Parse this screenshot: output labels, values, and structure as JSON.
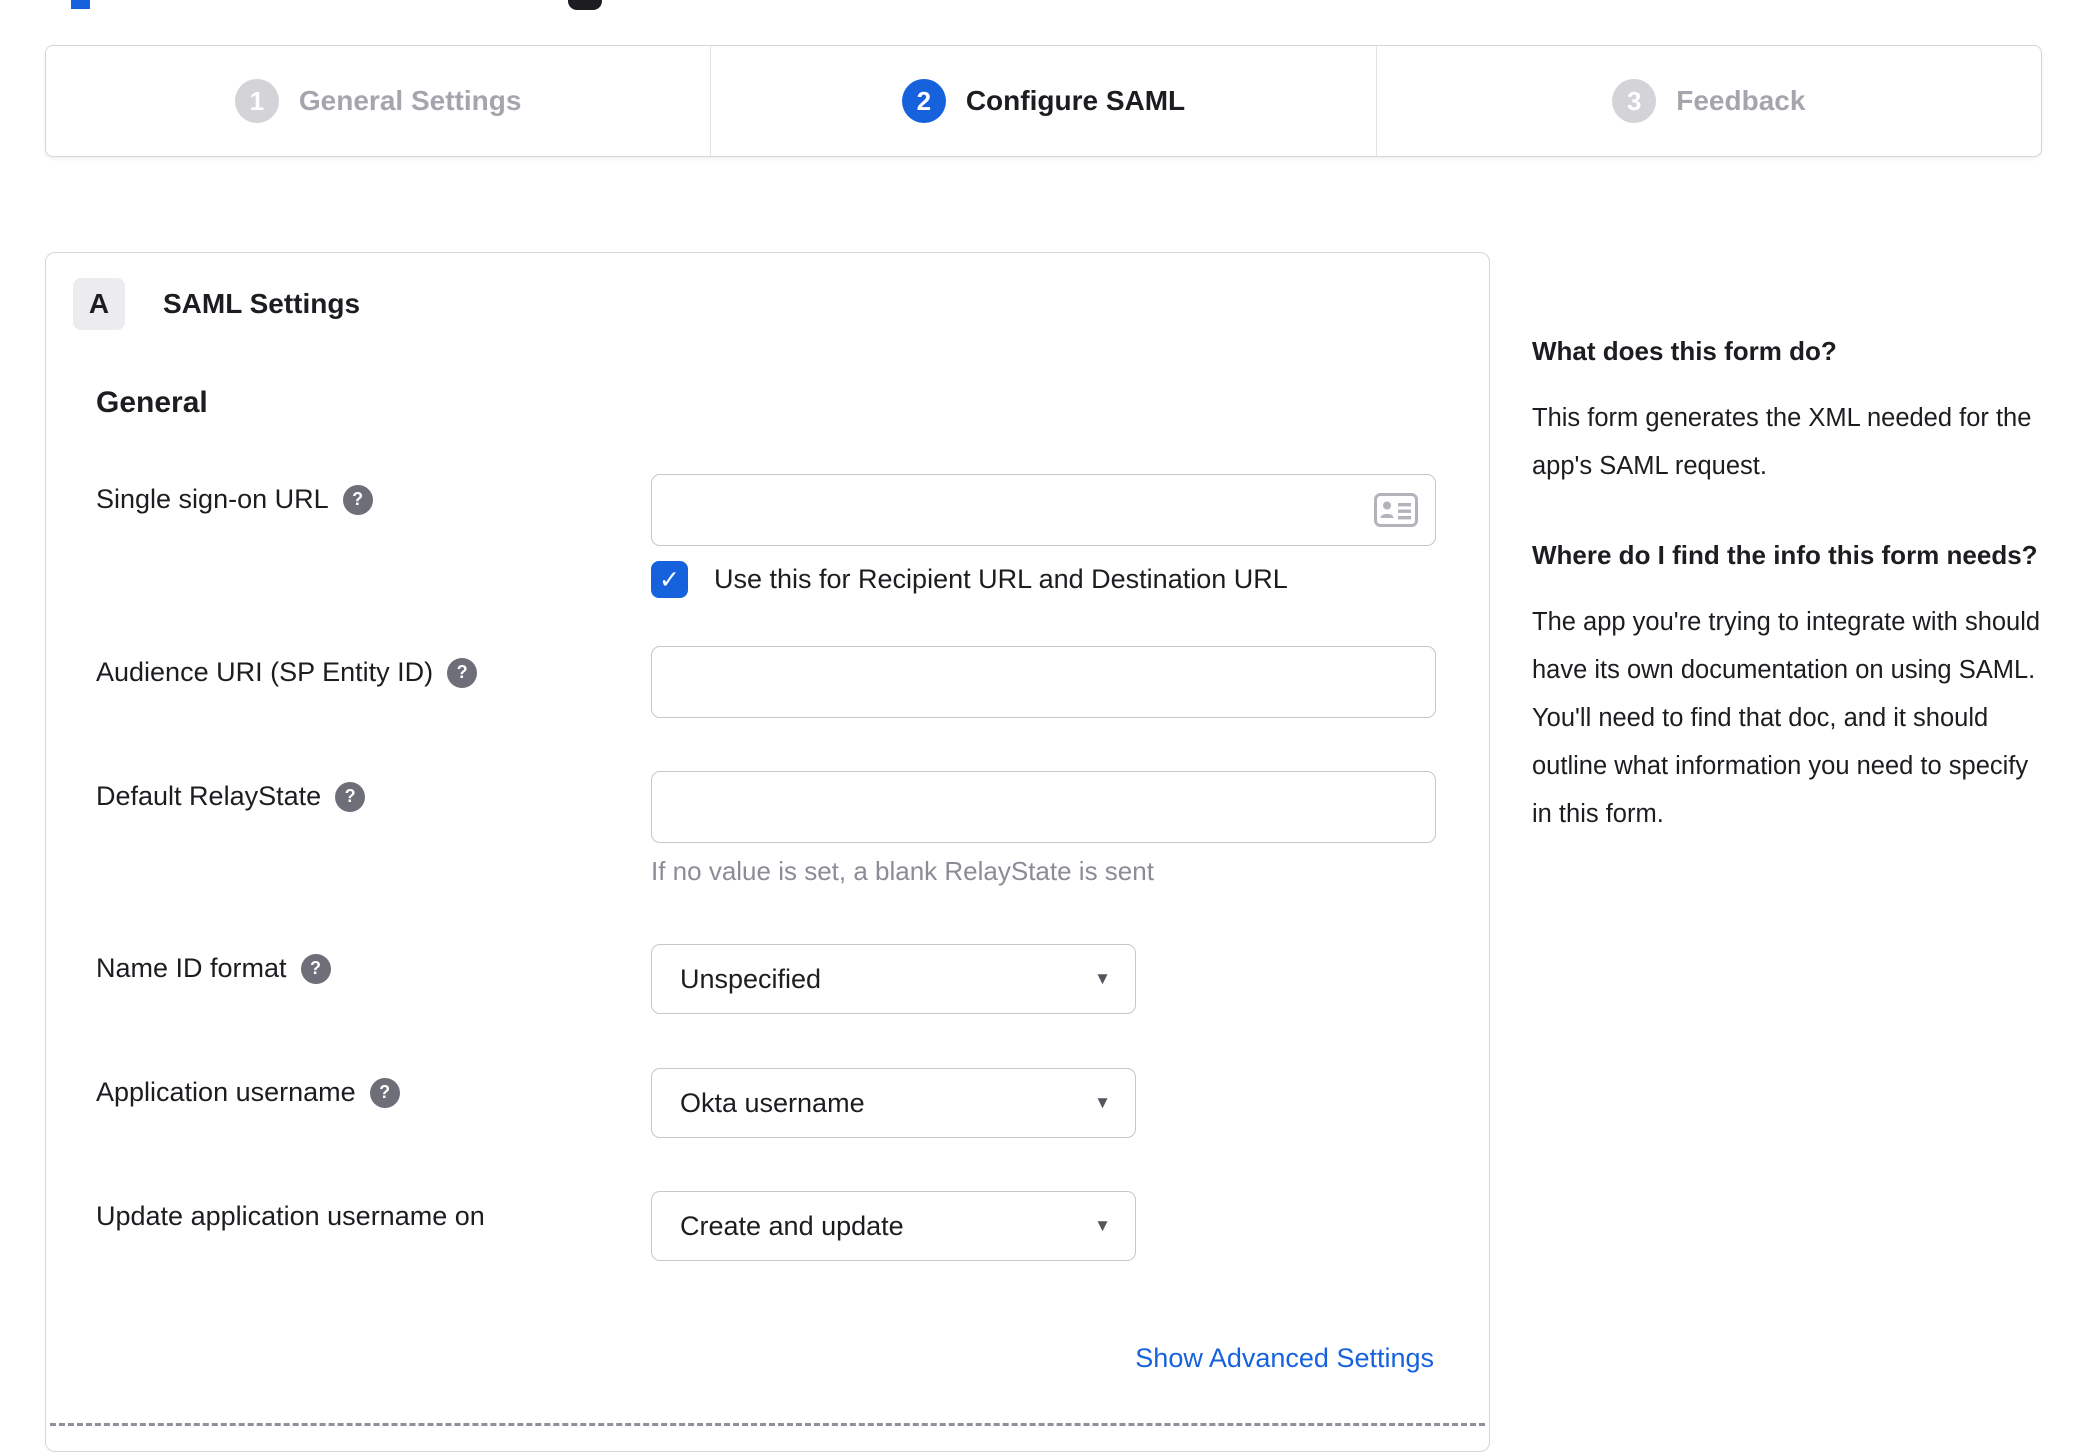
{
  "colors": {
    "accent_blue": "#1662dd",
    "inactive_step_gray": "#d3d3d8",
    "border_gray": "#d5d5da",
    "hint_gray": "#8c8c96",
    "header_fragment_dark": "#1d1d21"
  },
  "icons": {
    "check": "✓",
    "help": "?",
    "caret": "▼"
  },
  "stepper": {
    "steps": [
      {
        "number": "1",
        "label": "General Settings",
        "state": "inactive"
      },
      {
        "number": "2",
        "label": "Configure SAML",
        "state": "active"
      },
      {
        "number": "3",
        "label": "Feedback",
        "state": "inactive"
      }
    ]
  },
  "panel": {
    "section_badge": "A",
    "section_title": "SAML Settings",
    "group_heading": "General",
    "fields": {
      "sso": {
        "label": "Single sign-on URL",
        "value": "",
        "checkbox_checked": true,
        "checkbox_label": "Use this for Recipient URL and Destination URL"
      },
      "audience": {
        "label": "Audience URI (SP Entity ID)",
        "value": ""
      },
      "relaystate": {
        "label": "Default RelayState",
        "value": "",
        "hint": "If no value is set, a blank RelayState is sent"
      },
      "nameid": {
        "label": "Name ID format",
        "value": "Unspecified"
      },
      "app_username": {
        "label": "Application username",
        "value": "Okta username"
      },
      "update_username": {
        "label": "Update application username on",
        "value": "Create and update"
      }
    },
    "advanced_link_label": "Show Advanced Settings"
  },
  "sidebar": {
    "blocks": [
      {
        "heading": "What does this form do?",
        "body": "This form generates the XML needed for the app's SAML request."
      },
      {
        "heading": "Where do I find the info this form needs?",
        "body": "The app you're trying to integrate with should have its own documentation on using SAML. You'll need to find that doc, and it should outline what information you need to specify in this form."
      }
    ]
  }
}
